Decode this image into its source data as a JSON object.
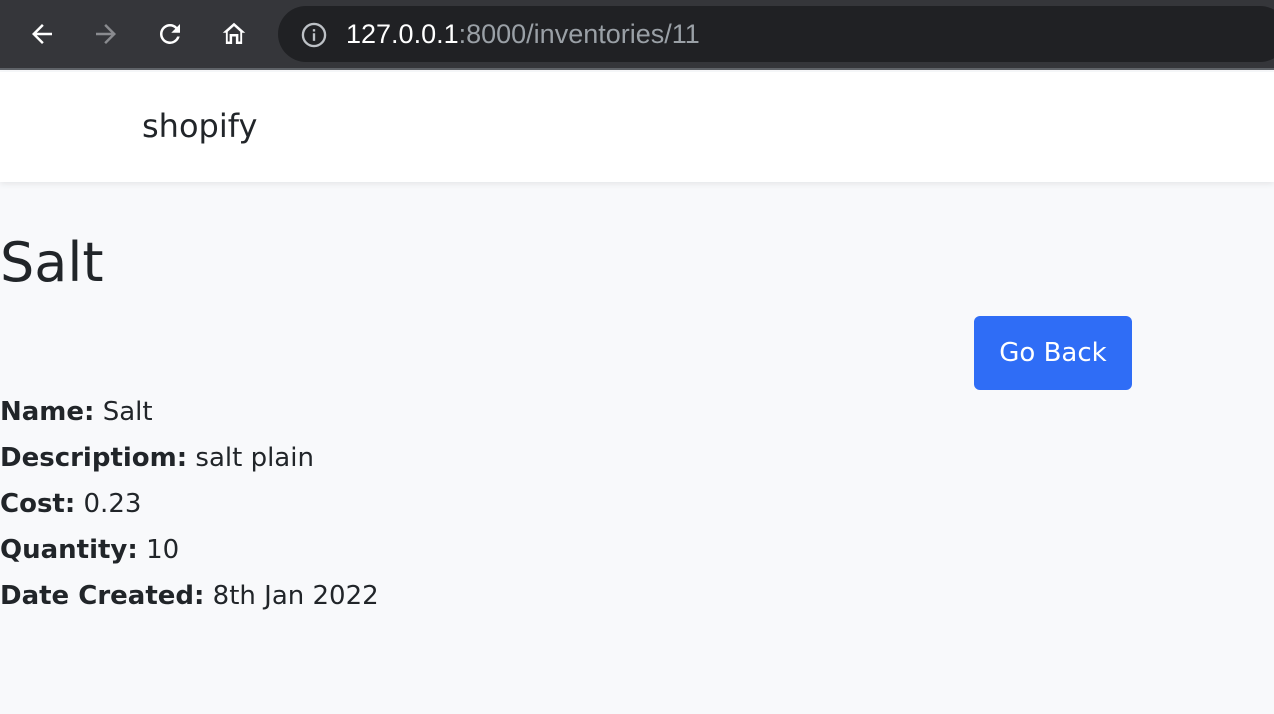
{
  "browser": {
    "url_host": "127.0.0.1",
    "url_path": ":8000/inventories/11"
  },
  "navbar": {
    "brand": "shopify"
  },
  "page": {
    "title": "Salt",
    "go_back_label": "Go Back"
  },
  "details": [
    {
      "label": "Name:",
      "value": "Salt"
    },
    {
      "label": "Descriptiom:",
      "value": "salt plain"
    },
    {
      "label": "Cost:",
      "value": "0.23"
    },
    {
      "label": "Quantity:",
      "value": "10"
    },
    {
      "label": "Date Created:",
      "value": "8th Jan 2022"
    }
  ],
  "colors": {
    "browser_chrome": "#35363a",
    "url_bar": "#202124",
    "page_background": "#f8f9fb",
    "primary_button": "#2f6df6",
    "text": "#212529"
  },
  "icons": [
    "back-arrow-icon",
    "forward-arrow-icon",
    "reload-icon",
    "home-icon",
    "info-icon"
  ]
}
